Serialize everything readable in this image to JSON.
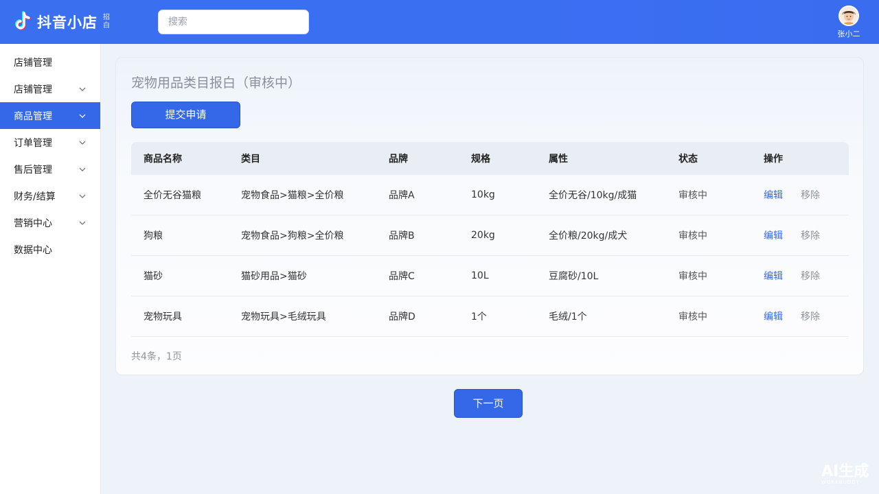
{
  "header": {
    "app_name": "抖音小店",
    "app_sub": "招白",
    "search_placeholder": "搜索",
    "user_name": "张小二"
  },
  "sidebar": {
    "items": [
      {
        "label": "店铺管理",
        "has_chevron": false,
        "active": false
      },
      {
        "label": "店铺管理",
        "has_chevron": true,
        "active": false
      },
      {
        "label": "商品管理",
        "has_chevron": true,
        "active": true
      },
      {
        "label": "订单管理",
        "has_chevron": true,
        "active": false
      },
      {
        "label": "售后管理",
        "has_chevron": true,
        "active": false
      },
      {
        "label": "财务/结算",
        "has_chevron": true,
        "active": false
      },
      {
        "label": "营销中心",
        "has_chevron": true,
        "active": false
      },
      {
        "label": "数据中心",
        "has_chevron": false,
        "active": false
      }
    ]
  },
  "main": {
    "title": "宠物用品类目报白（审核中）",
    "submit_label": "提交申请",
    "table": {
      "headers": [
        "商品名称",
        "类目",
        "品牌",
        "规格",
        "属性",
        "状态",
        "操作"
      ],
      "rows": [
        {
          "name": "全价无谷猫粮",
          "category": "宠物食品>猫粮>全价粮",
          "brand": "品牌A",
          "spec": "10kg",
          "attr": "全价无谷/10kg/成猫",
          "status": "审核中",
          "edit": "编辑",
          "remove": "移除"
        },
        {
          "name": "狗粮",
          "category": "宠物食品>狗粮>全价粮",
          "brand": "品牌B",
          "spec": "20kg",
          "attr": "全价粮/20kg/成犬",
          "status": "审核中",
          "edit": "编辑",
          "remove": "移除"
        },
        {
          "name": "猫砂",
          "category": "猫砂用品>猫砂",
          "brand": "品牌C",
          "spec": "10L",
          "attr": "豆腐砂/10L",
          "status": "审核中",
          "edit": "编辑",
          "remove": "移除"
        },
        {
          "name": "宠物玩具",
          "category": "宠物玩具>毛绒玩具",
          "brand": "品牌D",
          "spec": "1个",
          "attr": "毛绒/1个",
          "status": "审核中",
          "edit": "编辑",
          "remove": "移除"
        }
      ]
    },
    "footer_count": "共4条，1页",
    "next_label": "下一页"
  },
  "watermark": {
    "main": "AI生成",
    "sub": "WORKBUDDY"
  },
  "colors": {
    "primary": "#3468e8",
    "header_bg": "#3b6ff2",
    "muted_text": "#8e939b"
  }
}
